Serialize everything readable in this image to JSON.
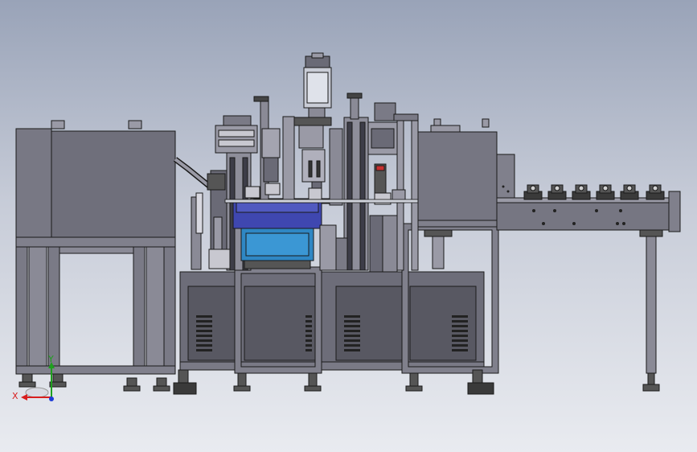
{
  "viewport": {
    "background_top": "#99a3b8",
    "background_bottom": "#e9ebf0",
    "part_color": "#73737f",
    "edge_color": "#1a1a1a",
    "bowl_color": "#3f47b0",
    "hopper_color": "#2f87c4"
  },
  "triad": {
    "x_label": "X",
    "y_label": "Y",
    "x_color": "#d81e1e",
    "y_color": "#1ea01e",
    "z_color": "#1e3cd8"
  }
}
